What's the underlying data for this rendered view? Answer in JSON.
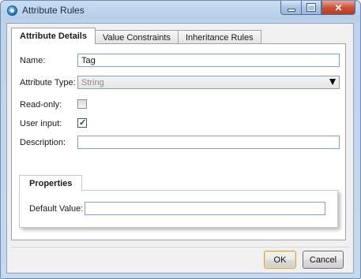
{
  "window": {
    "title": "Attribute Rules",
    "caption_buttons": {
      "minimize": "minimize",
      "maximize": "maximize",
      "close": "✕"
    }
  },
  "tabs": [
    {
      "label": "Attribute Details",
      "active": true
    },
    {
      "label": "Value Constraints",
      "active": false
    },
    {
      "label": "Inheritance Rules",
      "active": false
    }
  ],
  "form": {
    "name_label": "Name:",
    "name_value": "Tag",
    "attribute_type_label": "Attribute Type:",
    "attribute_type_value": "String",
    "read_only_label": "Read-only:",
    "read_only_checked": false,
    "user_input_label": "User input:",
    "user_input_checked": true,
    "description_label": "Description:",
    "description_value": ""
  },
  "properties": {
    "header": "Properties",
    "default_value_label": "Default Value:",
    "default_value": ""
  },
  "buttons": {
    "ok": "OK",
    "cancel": "Cancel"
  },
  "colors": {
    "frame": "#c6d9ee",
    "close_button": "#c9533b",
    "field_border": "#7fa2c8",
    "ok_border": "#d4a44e"
  }
}
